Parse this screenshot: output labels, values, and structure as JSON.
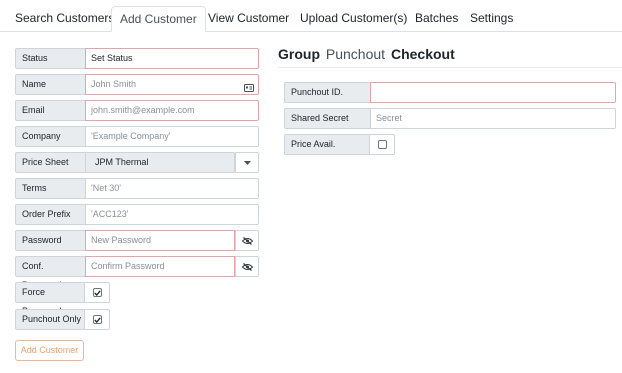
{
  "tabs": [
    "Search Customers",
    "Add Customer",
    "View Customer",
    "Upload Customer(s)",
    "Batches",
    "Settings"
  ],
  "form": {
    "status": {
      "label": "Status",
      "value": "Set Status"
    },
    "name": {
      "label": "Name",
      "placeholder": "John Smith"
    },
    "email": {
      "label": "Email",
      "placeholder": "john.smith@example.com"
    },
    "company": {
      "label": "Company",
      "placeholder": "'Example Company'"
    },
    "price_sheet": {
      "label": "Price Sheet",
      "value": "JPM Thermal"
    },
    "terms": {
      "label": "Terms",
      "placeholder": "'Net 30'"
    },
    "order_prefix": {
      "label": "Order Prefix",
      "placeholder": "'ACC123'"
    },
    "password": {
      "label": "Password",
      "placeholder": "New Password"
    },
    "conf_password": {
      "label": "Conf. Password",
      "placeholder": "Confirm Password"
    },
    "force_password": {
      "label": "Force Password",
      "checked": true
    },
    "punchout_only": {
      "label": "Punchout Only",
      "checked": true
    },
    "add_button": "Add Customer"
  },
  "punchout": {
    "title_left": "Group",
    "title_mid": "Punchout",
    "title_right": "Checkout",
    "punchout_id": {
      "label": "Punchout ID.",
      "placeholder": ""
    },
    "shared_secret": {
      "label": "Shared Secret",
      "placeholder": "Secret"
    },
    "price_avail": {
      "label": "Price Avail.",
      "checked": false
    }
  },
  "colors": {
    "invalid_border": "#e8a2a8",
    "accent": "#f0a070"
  }
}
